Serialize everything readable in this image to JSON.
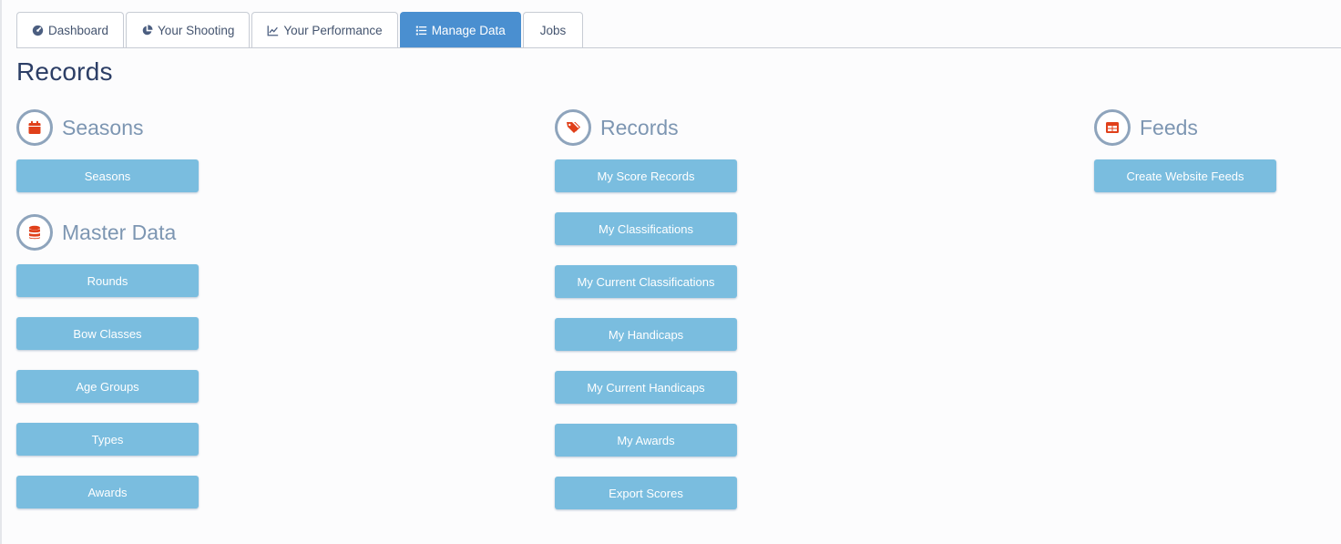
{
  "tabs": [
    {
      "label": "Dashboard",
      "icon": "dashboard-icon",
      "active": false
    },
    {
      "label": "Your Shooting",
      "icon": "pie-chart-icon",
      "active": false
    },
    {
      "label": "Your Performance",
      "icon": "line-chart-icon",
      "active": false
    },
    {
      "label": "Manage Data",
      "icon": "list-icon",
      "active": true
    },
    {
      "label": "Jobs",
      "icon": "",
      "active": false
    }
  ],
  "page_title": "Records",
  "sections": {
    "seasons": {
      "title": "Seasons",
      "icon": "calendar-icon",
      "buttons": [
        "Seasons"
      ]
    },
    "master_data": {
      "title": "Master Data",
      "icon": "database-icon",
      "buttons": [
        "Rounds",
        "Bow Classes",
        "Age Groups",
        "Types",
        "Awards"
      ]
    },
    "records": {
      "title": "Records",
      "icon": "tags-icon",
      "buttons": [
        "My Score Records",
        "My Classifications",
        "My Current Classifications",
        "My Handicaps",
        "My Current Handicaps",
        "My Awards",
        "Export Scores"
      ]
    },
    "feeds": {
      "title": "Feeds",
      "icon": "table-icon",
      "buttons": [
        "Create Website Feeds"
      ]
    }
  },
  "colors": {
    "accent": "#4a8fd0",
    "button": "#7abddf",
    "icon_red": "#e0401a",
    "heading": "#7d96b2"
  }
}
